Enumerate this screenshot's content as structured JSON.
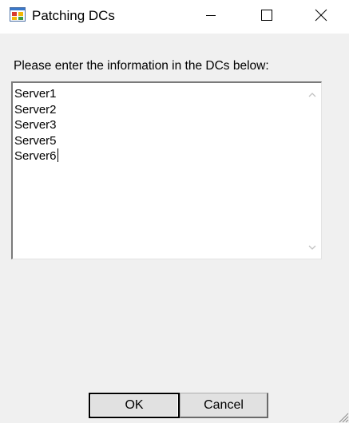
{
  "window": {
    "title": "Patching DCs",
    "icon": "app-window-icon",
    "controls": [
      "minimize-icon",
      "maximize-icon",
      "close-icon"
    ]
  },
  "prompt": {
    "label": "Please enter the information in the DCs below:"
  },
  "textarea": {
    "lines": [
      "Server1",
      "Server2",
      "Server3",
      "Server5",
      "Server6"
    ]
  },
  "buttons": {
    "ok_label": "OK",
    "cancel_label": "Cancel"
  },
  "colors": {
    "dialog_background": "#f0f0f0",
    "titlebar_background": "#ffffff",
    "button_face": "#e1e1e1"
  }
}
